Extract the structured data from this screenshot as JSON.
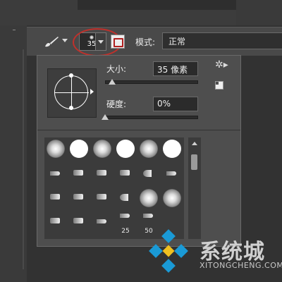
{
  "app": {
    "options_bar": {
      "brush_size_value": "35",
      "mode_label": "模式:",
      "mode_value": "正常"
    },
    "brush_panel": {
      "size_label": "大小:",
      "size_value": "35 像素",
      "size_slider_fraction": 0.08,
      "hardness_label": "硬度:",
      "hardness_value": "0%",
      "hardness_slider_fraction": 0.0,
      "presets_shown": 24,
      "preset_captions": [
        "25",
        "50"
      ]
    },
    "highlight_color": "#c0302b"
  },
  "watermark": {
    "title": "系统城",
    "subtitle": "XITONGCHENG.COM",
    "logo_color": "#1a9ad6"
  }
}
